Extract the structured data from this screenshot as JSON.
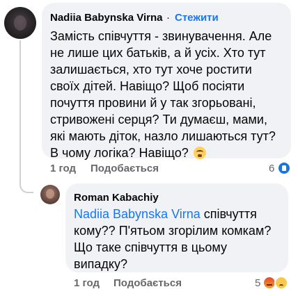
{
  "comment": {
    "author": "Nadiia Babynska Virna",
    "separator": "·",
    "follow_label": "Стежити",
    "lines": [
      "Замість співчуття - звинувачення. Але",
      "не лише цих батьків, а й усіх. Хто тут",
      "залишається, хто тут хоче ростити",
      "своїх дітей. Навіщо? Щоб посіяти",
      "почуття провини й у так згорьовані,",
      "стривожені серця? Ти думаєш, мами,",
      "які мають діток, назло лишаються тут?",
      "В чому логіка? Навіщо?"
    ],
    "emoji_icon": "fearful-face-emoji",
    "time": "1 год",
    "like_label": "Подобається",
    "reaction_count": "6",
    "reaction_icons": [
      "like-reaction"
    ]
  },
  "reply": {
    "author": "Roman Kabachiy",
    "mention": "Nadiia Babynska Virna",
    "lines": [
      " співчуття",
      "кому?? П'ятьом згорілим комкам?",
      "Що таке співчуття в цьому",
      "випадку?"
    ],
    "time": "1 год",
    "like_label": "Подобається",
    "reaction_count": "5",
    "reaction_icons": [
      "angry-reaction",
      "sad-reaction"
    ]
  },
  "colors": {
    "bubble": "#f0f2f5",
    "link": "#1876f2",
    "meta": "#65676b",
    "like_reaction": "#1b74e4"
  }
}
